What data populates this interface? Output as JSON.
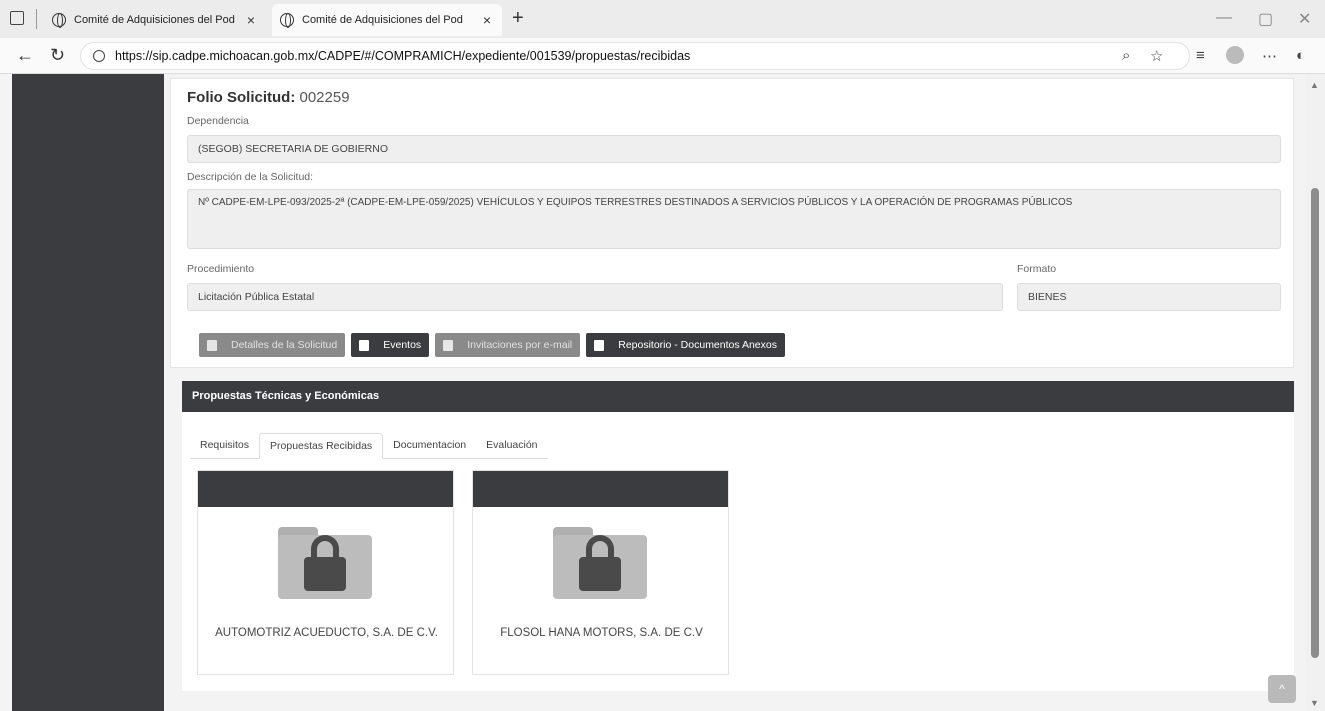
{
  "browser": {
    "tabs": [
      {
        "title": "Comité de Adquisiciones del Pod"
      },
      {
        "title": "Comité de Adquisiciones del Pod"
      }
    ],
    "url": "https://sip.cadpe.michoacan.gob.mx/CADPE/#/COMPRAMICH/expediente/001539/propuestas/recibidas"
  },
  "solicitud": {
    "folio_label": "Folio Solicitud:",
    "folio_value": "002259",
    "dependencia_label": "Dependencia",
    "dependencia_value": "(SEGOB)  SECRETARIA DE GOBIERNO",
    "descripcion_label": "Descripción de la Solicitud:",
    "descripcion_value": "Nº CADPE-EM-LPE-093/2025-2ª (CADPE-EM-LPE-059/2025) VEHÍCULOS Y EQUIPOS TERRESTRES DESTINADOS A SERVICIOS PÚBLICOS Y LA OPERACIÓN DE PROGRAMAS PÚBLICOS",
    "procedimiento_label": "Procedimiento",
    "procedimiento_value": "Licitación Pública Estatal",
    "formato_label": "Formato",
    "formato_value": "BIENES"
  },
  "actions": {
    "detalles": "Detalles de la Solicitud",
    "eventos": "Eventos",
    "invitaciones": "Invitaciones por e-mail",
    "repositorio": "Repositorio - Documentos Anexos"
  },
  "propuestas": {
    "header": "Propuestas Técnicas y Económicas",
    "tabs": [
      "Requisitos",
      "Propuestas Recibidas",
      "Documentacion",
      "Evaluación"
    ],
    "active_tab": "Propuestas Recibidas",
    "cards": [
      {
        "name": "AUTOMOTRIZ ACUEDUCTO, S.A. DE C.V.",
        "icon": "locked-folder-icon"
      },
      {
        "name": "FLOSOL HANA MOTORS, S.A. DE C.V",
        "icon": "locked-folder-icon"
      }
    ]
  },
  "colors": {
    "dark": "#3a3c3f",
    "disabled_button": "#8a8a8a"
  }
}
